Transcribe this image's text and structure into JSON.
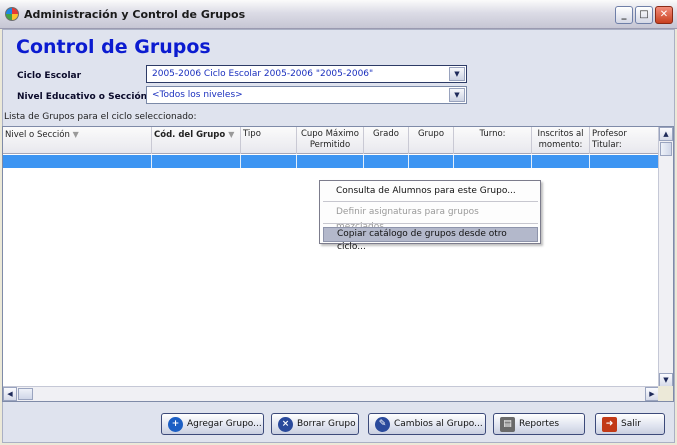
{
  "window": {
    "title": "Administración y Control de Grupos",
    "minimize_label": "_",
    "maximize_label": "□",
    "close_label": "✕"
  },
  "header": {
    "title": "Control de Grupos"
  },
  "filters": {
    "ciclo_label": "Ciclo Escolar",
    "ciclo_value": "2005-2006 Ciclo Escolar 2005-2006 \"2005-2006\"",
    "nivel_label": "Nivel Educativo o Sección",
    "nivel_value": "<Todos los niveles>"
  },
  "grid": {
    "caption": "Lista de Grupos para el ciclo seleccionado:",
    "columns": [
      "Nivel o Sección",
      "Cód. del Grupo",
      "Tipo",
      "Cupo Máximo Permitido",
      "Grado",
      "Grupo",
      "Turno:",
      "Inscritos al momento:",
      "Profesor Titular:"
    ]
  },
  "context_menu": {
    "items": [
      "Consulta de Alumnos para este Grupo...",
      "Definir asignaturas para grupos mezclados...",
      "Copiar catálogo de grupos desde otro ciclo..."
    ]
  },
  "buttons": {
    "agregar": "Agregar Grupo...",
    "borrar": "Borrar Grupo",
    "cambios": "Cambios al Grupo...",
    "reportes": "Reportes",
    "salir": "Salir"
  },
  "colors": {
    "title_blue": "#0b1bd0",
    "selection": "#3d95f2",
    "menu_highlight": "#b3b8cb"
  }
}
